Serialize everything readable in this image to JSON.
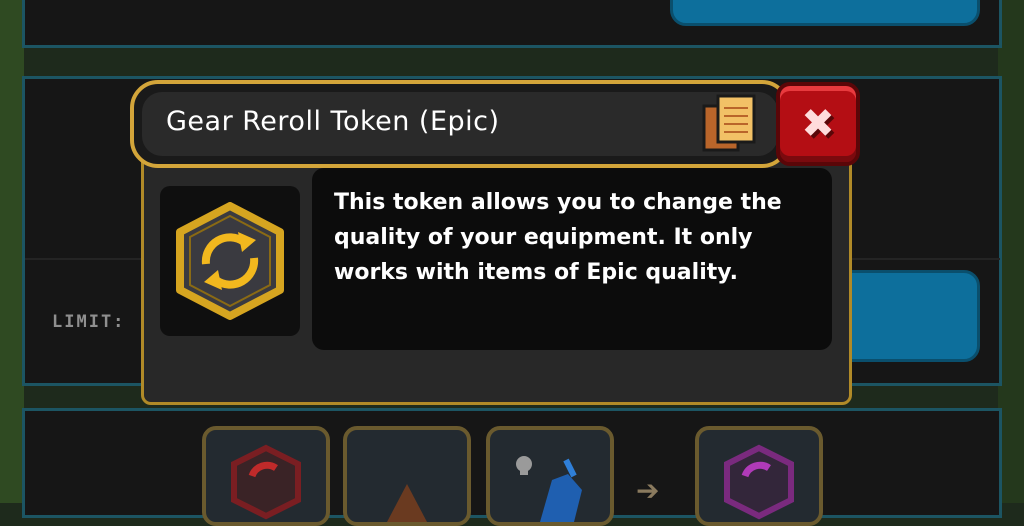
{
  "popup": {
    "title": "Gear Reroll Token (Epic)",
    "description": "This token allows you to change the quality of your equipment. It only works with items of Epic quality.",
    "close_icon": "close-x-icon",
    "header_icon": "scroll-document-icon",
    "item_icon": "reroll-token-icon"
  },
  "background": {
    "limit_label": "LIMIT:",
    "arrow": "➔"
  },
  "colors": {
    "gold_border": "#d3a53a",
    "close_red": "#b40e14",
    "panel_teal_border": "#1c5563",
    "button_blue": "#0d6f9c"
  }
}
